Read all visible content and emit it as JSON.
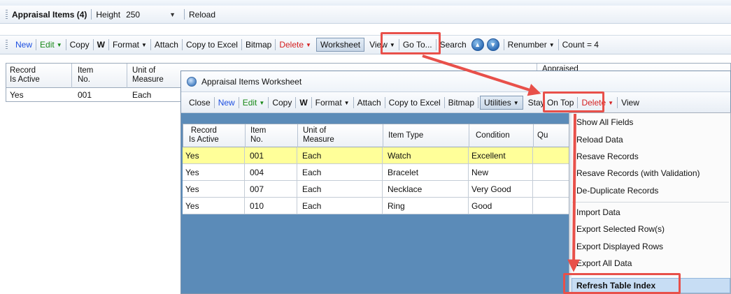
{
  "main": {
    "title": "Appraisal Items (4)",
    "height_label": "Height",
    "height_value": "250",
    "reload": "Reload",
    "toolbar": {
      "new": "New",
      "edit": "Edit",
      "copy": "Copy",
      "w": "W",
      "format": "Format",
      "attach": "Attach",
      "copy_to_excel": "Copy to Excel",
      "bitmap": "Bitmap",
      "delete": "Delete",
      "worksheet": "Worksheet",
      "view": "View",
      "goto": "Go To...",
      "search": "Search",
      "renumber": "Renumber",
      "count": "Count = 4"
    },
    "columns": [
      "Record\nIs Active",
      "Item\nNo.",
      "Unit of\nMeasure",
      "Appraised"
    ],
    "row": [
      "Yes",
      "001",
      "Each"
    ]
  },
  "worksheet": {
    "title": "Appraisal Items Worksheet",
    "toolbar": {
      "close": "Close",
      "new": "New",
      "edit": "Edit",
      "copy": "Copy",
      "w": "W",
      "format": "Format",
      "attach": "Attach",
      "copy_to_excel": "Copy to Excel",
      "bitmap": "Bitmap",
      "utilities": "Utilities",
      "stay_on_top": "Stay On Top",
      "delete": "Delete",
      "view": "View"
    },
    "columns": [
      "Record\nIs Active",
      "Item\nNo.",
      "Unit of\nMeasure",
      "Item Type",
      "Condition",
      "Qu"
    ],
    "rows": [
      [
        "Yes",
        "001",
        "Each",
        "Watch",
        "Excellent"
      ],
      [
        "Yes",
        "004",
        "Each",
        "Bracelet",
        "New"
      ],
      [
        "Yes",
        "007",
        "Each",
        "Necklace",
        "Very Good"
      ],
      [
        "Yes",
        "010",
        "Each",
        "Ring",
        "Good"
      ]
    ]
  },
  "utilities_menu": {
    "items": [
      "Show All Fields",
      "Reload Data",
      "Resave Records",
      "Resave Records (with Validation)",
      "De-Duplicate Records",
      "Import Data",
      "Export Selected Row(s)",
      "Export Displayed Rows",
      "Export All Data",
      "Refresh Table Index"
    ]
  },
  "colors": {
    "selected_row": "#ffff99",
    "grid_background": "#5b8bb8",
    "callout": "#e8504a",
    "menu_highlight": "#c7ddf4"
  }
}
